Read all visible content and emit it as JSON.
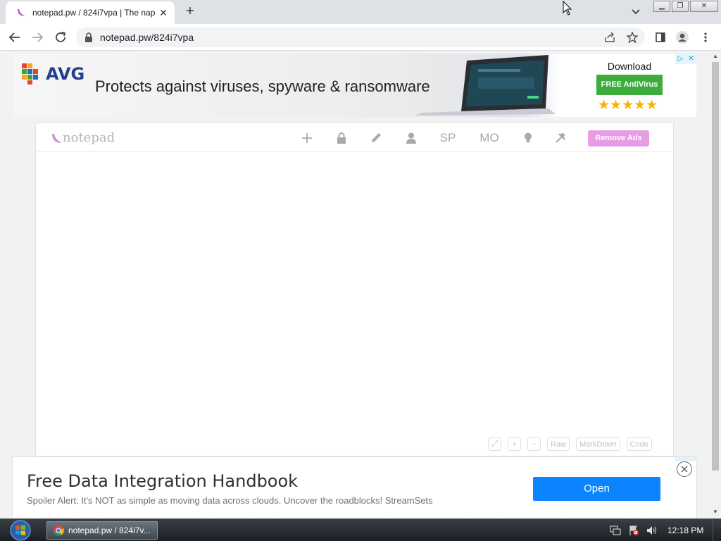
{
  "browser": {
    "tab_title": "notepad.pw / 824i7vpa | The nap",
    "url": "notepad.pw/824i7vpa"
  },
  "ad_top": {
    "brand": "AVG",
    "headline": "Protects against viruses, spyware & ransomware",
    "download": "Download",
    "cta": "FREE AntiVirus",
    "stars": "★★★★★",
    "adchoices": "▷"
  },
  "notepad": {
    "logo": "notepad",
    "header_items": {
      "sp": "SP",
      "mo": "MO"
    },
    "remove_ads": "Remove Ads",
    "format_buttons": {
      "raw": "Raw",
      "markdown": "MarkDown",
      "code": "Code"
    }
  },
  "ad_bottom": {
    "title": "Free Data Integration Handbook",
    "subtitle": "Spoiler Alert: It's NOT as simple as moving data across clouds. Uncover the roadblocks! StreamSets",
    "cta": "Open"
  },
  "taskbar": {
    "task_label": "notepad.pw / 824i7v...",
    "clock": "12:18 PM"
  },
  "colors": {
    "accent_pink": "#e79de3",
    "open_button": "#0a84ff",
    "avg_green": "#3cac3c",
    "stars": "#f6b400"
  }
}
